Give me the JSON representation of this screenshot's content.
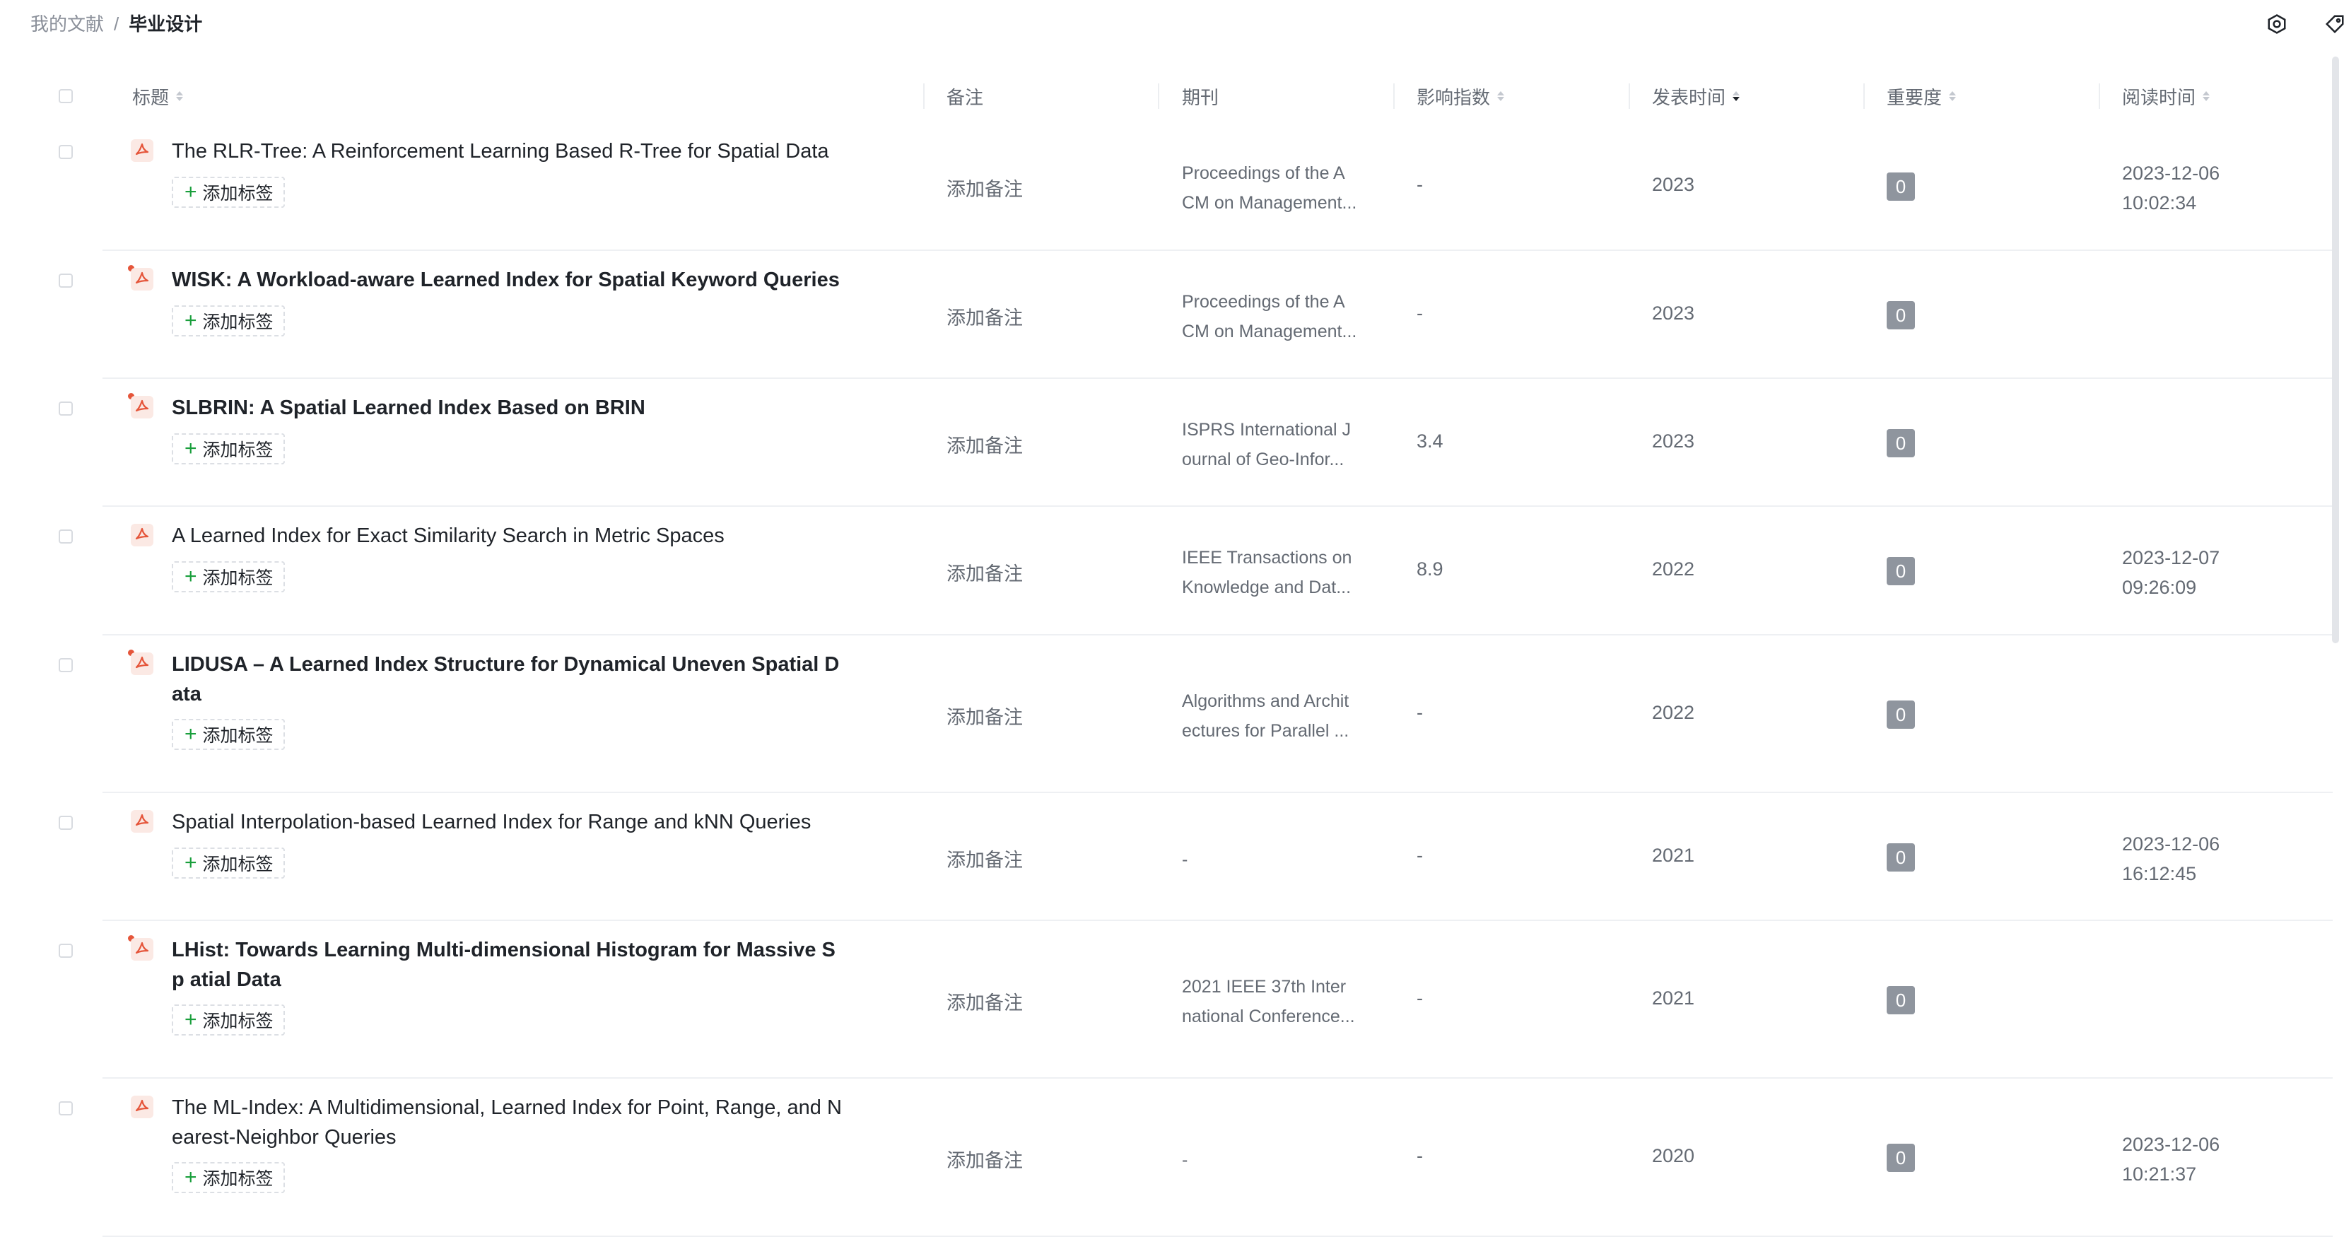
{
  "breadcrumb": {
    "parent": "我的文献",
    "separator": "/",
    "current": "毕业设计"
  },
  "toolbar": {
    "icons": [
      "settings-icon",
      "tag-icon",
      "grid-apps-icon"
    ]
  },
  "columns": {
    "title": "标题",
    "note": "备注",
    "journal": "期刊",
    "impact": "影响指数",
    "published": "发表时间",
    "importance": "重要度",
    "read_time": "阅读时间"
  },
  "sort": {
    "active_column": "发表时间",
    "direction": "descending"
  },
  "colors": {
    "unread_dot": "#e5553a",
    "pdf_icon": "#e5553a",
    "plus": "#1a9f3c",
    "badge": "#8f959e"
  },
  "rows": [
    {
      "title": "The RLR-Tree: A Reinforcement Learning Based R-Tree for Spatial Data",
      "unread": false,
      "tag_button": "添加标签",
      "note": "添加备注",
      "journal": [
        "Proceedings of the A",
        "CM on Management..."
      ],
      "impact": "-",
      "year": "2023",
      "importance": "0",
      "read_time": [
        "2023-12-06",
        "10:02:34"
      ]
    },
    {
      "title": "WISK: A Workload-aware Learned Index for Spatial Keyword Queries",
      "unread": true,
      "tag_button": "添加标签",
      "note": "添加备注",
      "journal": [
        "Proceedings of the A",
        "CM on Management..."
      ],
      "impact": "-",
      "year": "2023",
      "importance": "0",
      "read_time": []
    },
    {
      "title": "SLBRIN: A Spatial Learned Index Based on BRIN",
      "unread": true,
      "tag_button": "添加标签",
      "note": "添加备注",
      "journal": [
        "ISPRS International J",
        "ournal of Geo-Infor..."
      ],
      "impact": "3.4",
      "year": "2023",
      "importance": "0",
      "read_time": []
    },
    {
      "title": "A Learned Index for Exact Similarity Search in Metric Spaces",
      "unread": false,
      "tag_button": "添加标签",
      "note": "添加备注",
      "journal": [
        "IEEE Transactions on",
        "Knowledge and Dat..."
      ],
      "impact": "8.9",
      "year": "2022",
      "importance": "0",
      "read_time": [
        "2023-12-07",
        "09:26:09"
      ]
    },
    {
      "title": "LIDUSA – A Learned Index Structure for Dynamical Uneven Spatial D ata",
      "unread": true,
      "tag_button": "添加标签",
      "note": "添加备注",
      "journal": [
        "Algorithms and Archit",
        "ectures for Parallel ..."
      ],
      "impact": "-",
      "year": "2022",
      "importance": "0",
      "read_time": []
    },
    {
      "title": "Spatial Interpolation-based Learned Index for Range and kNN Queries",
      "unread": false,
      "tag_button": "添加标签",
      "note": "添加备注",
      "journal": [
        "-"
      ],
      "impact": "-",
      "year": "2021",
      "importance": "0",
      "read_time": [
        "2023-12-06",
        "16:12:45"
      ]
    },
    {
      "title": "LHist: Towards Learning Multi-dimensional Histogram for Massive Sp atial Data",
      "unread": true,
      "tag_button": "添加标签",
      "note": "添加备注",
      "journal": [
        "2021 IEEE 37th Inter",
        "national Conference..."
      ],
      "impact": "-",
      "year": "2021",
      "importance": "0",
      "read_time": []
    },
    {
      "title": "The ML-Index: A Multidimensional, Learned Index for Point, Range, and Nearest-Neighbor Queries",
      "unread": false,
      "tag_button": "添加标签",
      "note": "添加备注",
      "journal": [
        "-"
      ],
      "impact": "-",
      "year": "2020",
      "importance": "0",
      "read_time": [
        "2023-12-06",
        "10:21:37"
      ]
    }
  ]
}
